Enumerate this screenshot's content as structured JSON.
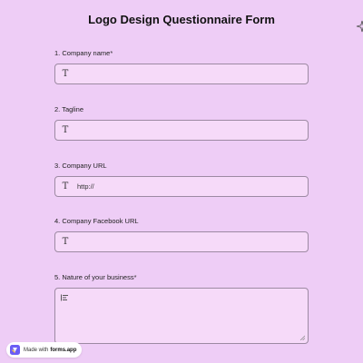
{
  "form": {
    "title": "Logo Design Questionnaire Form"
  },
  "questions": [
    {
      "number": "1.",
      "label": "Company name",
      "required_mark": "*",
      "icon": "text-type-icon",
      "icon_glyph": "T",
      "value": ""
    },
    {
      "number": "2.",
      "label": "Tagline",
      "required_mark": "",
      "icon": "text-type-icon",
      "icon_glyph": "T",
      "value": ""
    },
    {
      "number": "3.",
      "label": "Company URL",
      "required_mark": "",
      "icon": "text-type-icon",
      "icon_glyph": "T",
      "value": "http://"
    },
    {
      "number": "4.",
      "label": "Company Facebook URL",
      "required_mark": "",
      "icon": "text-type-icon",
      "icon_glyph": "T",
      "value": ""
    },
    {
      "number": "5.",
      "label": "Nature of your business",
      "required_mark": "*",
      "icon": "paragraph-lines-icon",
      "value": ""
    }
  ],
  "badge": {
    "made_with": "Made with",
    "brand": "forms.app"
  },
  "colors": {
    "background": "#eecdf6",
    "field_background": "#f6daf9",
    "field_border": "#9d8aa3",
    "brand_logo": "#6b5cf5"
  }
}
